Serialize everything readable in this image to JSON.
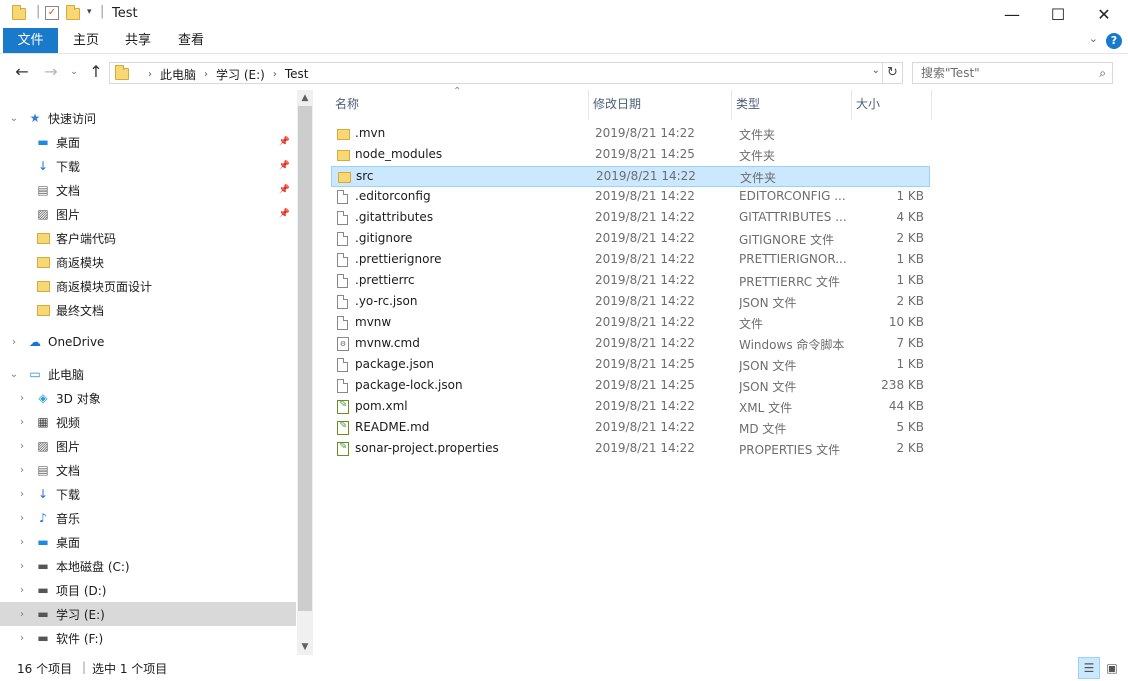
{
  "window": {
    "title": "Test",
    "minimize": "—",
    "maximize": "☐",
    "close": "✕"
  },
  "ribbon": {
    "tabs": [
      "文件",
      "主页",
      "共享",
      "查看"
    ],
    "help": "?"
  },
  "address": {
    "breadcrumb": [
      "此电脑",
      "学习 (E:)",
      "Test"
    ],
    "search_placeholder": "搜索\"Test\""
  },
  "nav": {
    "items": [
      {
        "label": "快速访问",
        "icon": "star-icon",
        "level": 0,
        "expand": "⌄",
        "pinned": false
      },
      {
        "label": "桌面",
        "icon": "desktop-icon",
        "level": 1,
        "pinned": true
      },
      {
        "label": "下载",
        "icon": "download-icon",
        "level": 1,
        "pinned": true
      },
      {
        "label": "文档",
        "icon": "document-icon",
        "level": 1,
        "pinned": true
      },
      {
        "label": "图片",
        "icon": "picture-icon",
        "level": 1,
        "pinned": true
      },
      {
        "label": "客户端代码",
        "icon": "folder-icon",
        "level": 1,
        "pinned": false
      },
      {
        "label": "商返模块",
        "icon": "folder-icon",
        "level": 1,
        "pinned": false
      },
      {
        "label": "商返模块页面设计",
        "icon": "folder-icon",
        "level": 1,
        "pinned": false
      },
      {
        "label": "最终文档",
        "icon": "folder-icon",
        "level": 1,
        "pinned": false
      },
      {
        "label": "OneDrive",
        "icon": "cloud-icon",
        "level": 0,
        "expand": "›",
        "pinned": false,
        "gap": true
      },
      {
        "label": "此电脑",
        "icon": "pc-icon",
        "level": 0,
        "expand": "⌄",
        "pinned": false,
        "gap": true
      },
      {
        "label": "3D 对象",
        "icon": "3d-objects-icon",
        "level": 1,
        "expand": "›",
        "pinned": false
      },
      {
        "label": "视频",
        "icon": "video-icon",
        "level": 1,
        "expand": "›",
        "pinned": false
      },
      {
        "label": "图片",
        "icon": "picture-icon",
        "level": 1,
        "expand": "›",
        "pinned": false
      },
      {
        "label": "文档",
        "icon": "document-icon",
        "level": 1,
        "expand": "›",
        "pinned": false
      },
      {
        "label": "下载",
        "icon": "download-icon",
        "level": 1,
        "expand": "›",
        "pinned": false
      },
      {
        "label": "音乐",
        "icon": "music-icon",
        "level": 1,
        "expand": "›",
        "pinned": false
      },
      {
        "label": "桌面",
        "icon": "desktop-icon",
        "level": 1,
        "expand": "›",
        "pinned": false
      },
      {
        "label": "本地磁盘 (C:)",
        "icon": "drive-c-icon",
        "level": 1,
        "expand": "›",
        "pinned": false
      },
      {
        "label": "项目 (D:)",
        "icon": "drive-icon",
        "level": 1,
        "expand": "›",
        "pinned": false
      },
      {
        "label": "学习 (E:)",
        "icon": "drive-icon",
        "level": 1,
        "expand": "›",
        "pinned": false,
        "selected": true
      },
      {
        "label": "软件 (F:)",
        "icon": "drive-icon",
        "level": 1,
        "expand": "›",
        "pinned": false
      }
    ]
  },
  "columns": {
    "name": "名称",
    "date": "修改日期",
    "type": "类型",
    "size": "大小"
  },
  "files": [
    {
      "name": ".mvn",
      "date": "2019/8/21 14:22",
      "type": "文件夹",
      "size": "",
      "icon": "folder-icon"
    },
    {
      "name": "node_modules",
      "date": "2019/8/21 14:25",
      "type": "文件夹",
      "size": "",
      "icon": "folder-icon"
    },
    {
      "name": "src",
      "date": "2019/8/21 14:22",
      "type": "文件夹",
      "size": "",
      "icon": "folder-icon",
      "selected": true
    },
    {
      "name": ".editorconfig",
      "date": "2019/8/21 14:22",
      "type": "EDITORCONFIG ...",
      "size": "1 KB",
      "icon": "file-icon"
    },
    {
      "name": ".gitattributes",
      "date": "2019/8/21 14:22",
      "type": "GITATTRIBUTES ...",
      "size": "4 KB",
      "icon": "file-icon"
    },
    {
      "name": ".gitignore",
      "date": "2019/8/21 14:22",
      "type": "GITIGNORE 文件",
      "size": "2 KB",
      "icon": "file-icon"
    },
    {
      "name": ".prettierignore",
      "date": "2019/8/21 14:22",
      "type": "PRETTIERIGNOR...",
      "size": "1 KB",
      "icon": "file-icon"
    },
    {
      "name": ".prettierrc",
      "date": "2019/8/21 14:22",
      "type": "PRETTIERRC 文件",
      "size": "1 KB",
      "icon": "file-icon"
    },
    {
      "name": ".yo-rc.json",
      "date": "2019/8/21 14:22",
      "type": "JSON 文件",
      "size": "2 KB",
      "icon": "file-icon"
    },
    {
      "name": "mvnw",
      "date": "2019/8/21 14:22",
      "type": "文件",
      "size": "10 KB",
      "icon": "file-icon"
    },
    {
      "name": "mvnw.cmd",
      "date": "2019/8/21 14:22",
      "type": "Windows 命令脚本",
      "size": "7 KB",
      "icon": "cmd-icon"
    },
    {
      "name": "package.json",
      "date": "2019/8/21 14:25",
      "type": "JSON 文件",
      "size": "1 KB",
      "icon": "file-icon"
    },
    {
      "name": "package-lock.json",
      "date": "2019/8/21 14:25",
      "type": "JSON 文件",
      "size": "238 KB",
      "icon": "file-icon"
    },
    {
      "name": "pom.xml",
      "date": "2019/8/21 14:22",
      "type": "XML 文件",
      "size": "44 KB",
      "icon": "xml-icon"
    },
    {
      "name": "README.md",
      "date": "2019/8/21 14:22",
      "type": "MD 文件",
      "size": "5 KB",
      "icon": "xml-icon"
    },
    {
      "name": "sonar-project.properties",
      "date": "2019/8/21 14:22",
      "type": "PROPERTIES 文件",
      "size": "2 KB",
      "icon": "xml-icon"
    }
  ],
  "status": {
    "item_count": "16 个项目",
    "selected": "选中 1 个项目"
  },
  "colors": {
    "accent": "#1979ca",
    "selection": "#cce8ff",
    "selection_border": "#99d1ff",
    "folder": "#f8d775"
  }
}
